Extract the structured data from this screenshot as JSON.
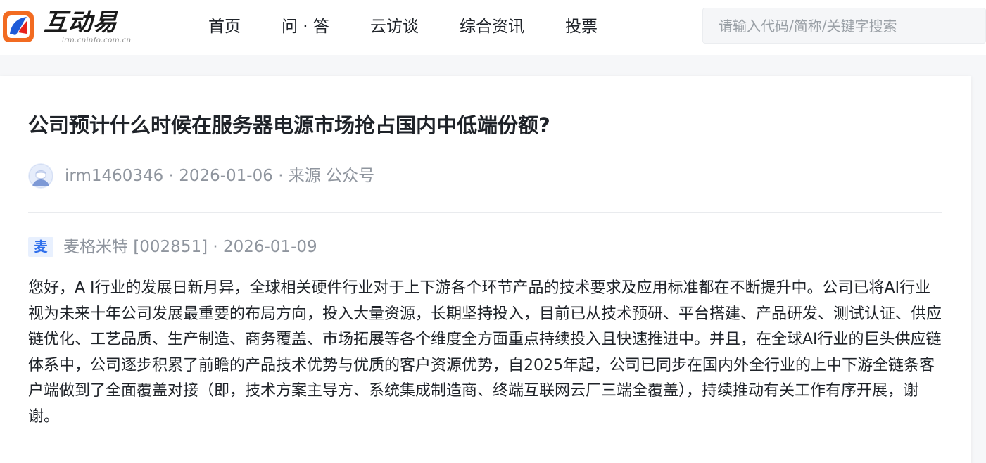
{
  "header": {
    "logo": {
      "title": "互动易",
      "subtitle": "irm.cninfo.com.cn",
      "colors": {
        "orange": "#f26b21",
        "blue": "#1e5bd8",
        "red": "#e8221c"
      }
    },
    "nav": [
      {
        "label": "首页"
      },
      {
        "label": "问 · 答"
      },
      {
        "label": "云访谈"
      },
      {
        "label": "综合资讯"
      },
      {
        "label": "投票"
      }
    ],
    "search": {
      "placeholder": "请输入代码/简称/关键字搜索",
      "value": ""
    }
  },
  "question": {
    "title": "公司预计什么时候在服务器电源市场抢占国内中低端份额?",
    "meta": "irm1460346 · 2026-01-06 · 来源 公众号",
    "avatar_icon": "user-avatar-icon"
  },
  "answer": {
    "badge": "麦",
    "meta": "麦格米特 [002851] · 2026-01-09",
    "body": "您好，A I行业的发展日新月异，全球相关硬件行业对于上下游各个环节产品的技术要求及应用标准都在不断提升中。公司已将AI行业视为未来十年公司发展最重要的布局方向，投入大量资源，长期坚持投入，目前已从技术预研、平台搭建、产品研发、测试认证、供应链优化、工艺品质、生产制造、商务覆盖、市场拓展等各个维度全方面重点持续投入且快速推进中。并且，在全球AI行业的巨头供应链体系中，公司逐步积累了前瞻的产品技术优势与优质的客户资源优势，自2025年起，公司已同步在国内外全行业的上中下游全链条客户端做到了全面覆盖对接（即，技术方案主导方、系统集成制造商、终端互联网云厂三端全覆盖），持续推动有关工作有序开展，谢谢。"
  },
  "colors": {
    "accent": "#2f6fec",
    "badge_bg": "#e8f0fe",
    "muted_text": "#8f959e",
    "body_text": "#1f2329"
  }
}
